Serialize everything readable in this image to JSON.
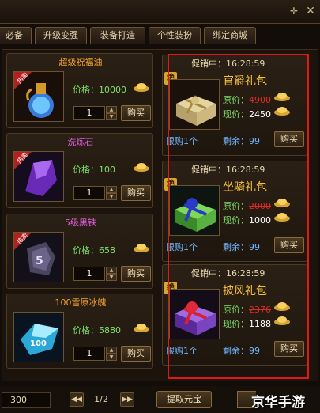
{
  "tabs": [
    {
      "label": "必备"
    },
    {
      "label": "升级变强"
    },
    {
      "label": "装备打造"
    },
    {
      "label": "个性装扮"
    },
    {
      "label": "绑定商城"
    }
  ],
  "left_items": [
    {
      "name": "超级祝福油",
      "name_color": "#f0a030",
      "hot": "热卖",
      "price_label": "价格：10000",
      "qty": "1",
      "buy": "购买",
      "icon": "oil-bottle-icon"
    },
    {
      "name": "洗炼石",
      "name_color": "#e060e0",
      "hot": "热卖",
      "price_label": "价格：100",
      "qty": "1",
      "buy": "购买",
      "icon": "purple-stone-icon"
    },
    {
      "name": "5级黑铁",
      "name_color": "#e060e0",
      "hot": "热卖",
      "price_label": "价格：658",
      "qty": "1",
      "buy": "购买",
      "icon": "black-iron-icon"
    },
    {
      "name": "100雪原冰魄",
      "name_color": "#f0a030",
      "hot": "",
      "price_label": "价格：5880",
      "qty": "1",
      "buy": "购买",
      "icon": "ice-crystal-icon"
    }
  ],
  "right_items": [
    {
      "timer": "促销中：16:28:59",
      "badge": "绝",
      "name": "官爵礼包",
      "orig_label": "原价：",
      "orig": "4900",
      "now_label": "现价：",
      "now": "2450",
      "limit": "限购1个",
      "remain_label": "剩余：",
      "remain": "99",
      "buy": "购买",
      "icon": "gold-gift-box-icon"
    },
    {
      "timer": "促销中：16:28:59",
      "badge": "绝",
      "name": "坐骑礼包",
      "orig_label": "原价：",
      "orig": "2000",
      "now_label": "现价：",
      "now": "1000",
      "limit": "限购1个",
      "remain_label": "剩余：",
      "remain": "99",
      "buy": "购买",
      "icon": "green-gift-box-icon"
    },
    {
      "timer": "促销中：16:28:59",
      "badge": "绝",
      "name": "披风礼包",
      "orig_label": "原价：",
      "orig": "2376",
      "now_label": "现价：",
      "now": "1188",
      "limit": "限购1个",
      "remain_label": "剩余：",
      "remain": "99",
      "buy": "购买",
      "icon": "purple-gift-box-icon"
    }
  ],
  "bottom": {
    "balance": "300",
    "prev": "◀◀",
    "page": "1/2",
    "next": "▶▶",
    "withdraw": "提取元宝"
  },
  "watermark": "京华手游",
  "colors": {
    "highlight_border": "#e01818",
    "gold": "#f6c23a",
    "green": "#7fe06a",
    "blue": "#6fb8ff"
  }
}
